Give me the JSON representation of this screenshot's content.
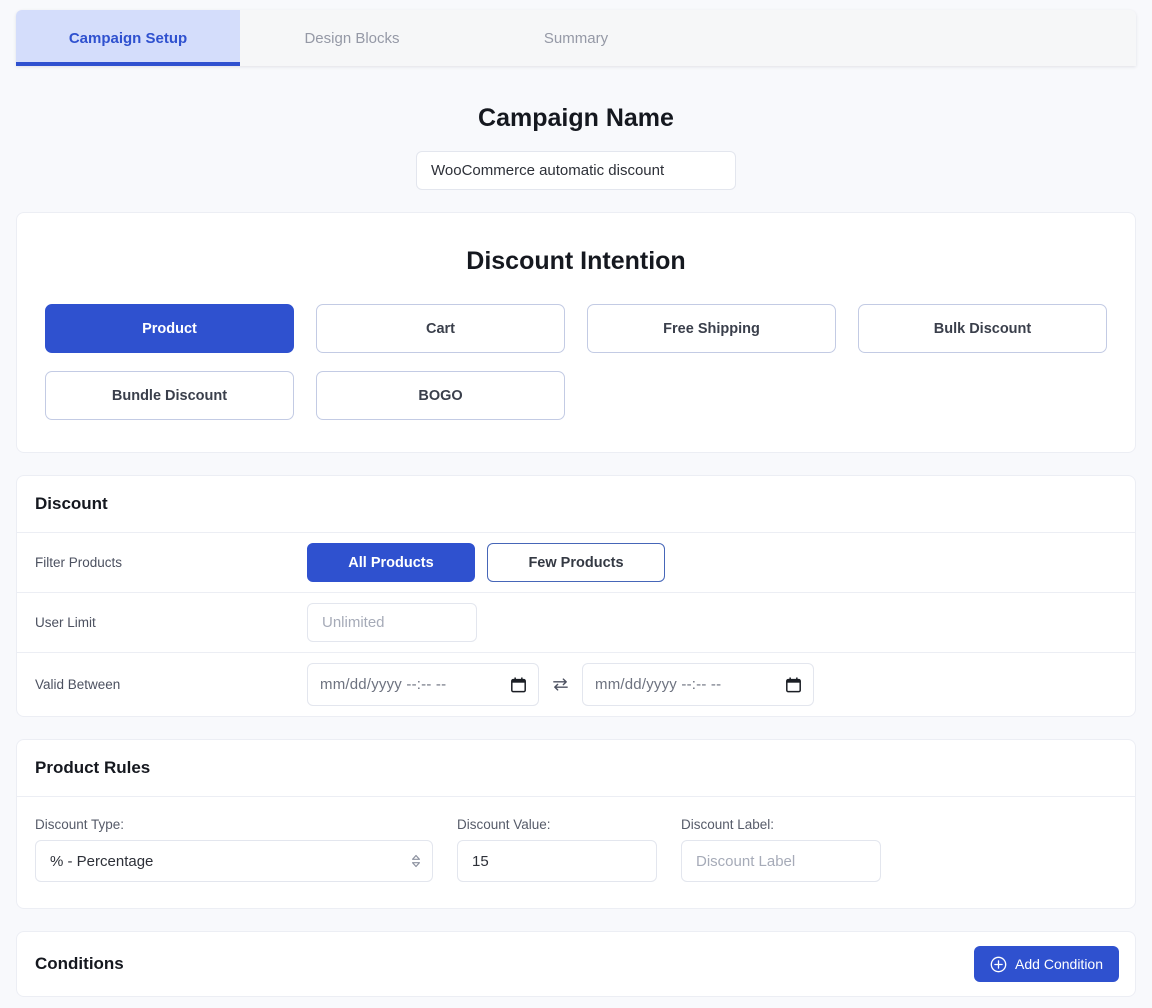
{
  "tabs": [
    {
      "label": "Campaign Setup",
      "active": true
    },
    {
      "label": "Design Blocks",
      "active": false
    },
    {
      "label": "Summary",
      "active": false
    }
  ],
  "campaign": {
    "title": "Campaign Name",
    "value": "WooCommerce automatic discount",
    "placeholder": "Campaign Name"
  },
  "intention": {
    "heading": "Discount Intention",
    "options": [
      {
        "label": "Product",
        "selected": true
      },
      {
        "label": "Cart",
        "selected": false
      },
      {
        "label": "Free Shipping",
        "selected": false
      },
      {
        "label": "Bulk Discount",
        "selected": false
      },
      {
        "label": "Bundle Discount",
        "selected": false
      },
      {
        "label": "BOGO",
        "selected": false
      }
    ]
  },
  "discount": {
    "heading": "Discount",
    "filter_label": "Filter Products",
    "filter_all": "All Products",
    "filter_few": "Few Products",
    "user_limit_label": "User Limit",
    "user_limit_placeholder": "Unlimited",
    "user_limit_value": "",
    "valid_between_label": "Valid Between",
    "date_start": "mm/dd/yyyy --:-- --",
    "date_end": "mm/dd/yyyy --:-- --",
    "swap_icon": "swap-arrows-icon",
    "calendar_icon": "calendar-icon"
  },
  "product_rules": {
    "heading": "Product Rules",
    "discount_type_label": "Discount Type:",
    "discount_type_value": "% - Percentage",
    "discount_value_label": "Discount Value:",
    "discount_value": "15",
    "discount_label_label": "Discount Label:",
    "discount_label_placeholder": "Discount Label",
    "discount_label_value": ""
  },
  "conditions": {
    "heading": "Conditions",
    "add_label": "Add Condition",
    "add_icon": "circle-plus-icon"
  },
  "colors": {
    "accent": "#2f51cf",
    "accent_soft": "#d4ddfb",
    "page_bg": "#f8f9fc",
    "card_bg": "#ffffff",
    "border": "#eceef4",
    "muted_text": "#9599a6"
  }
}
